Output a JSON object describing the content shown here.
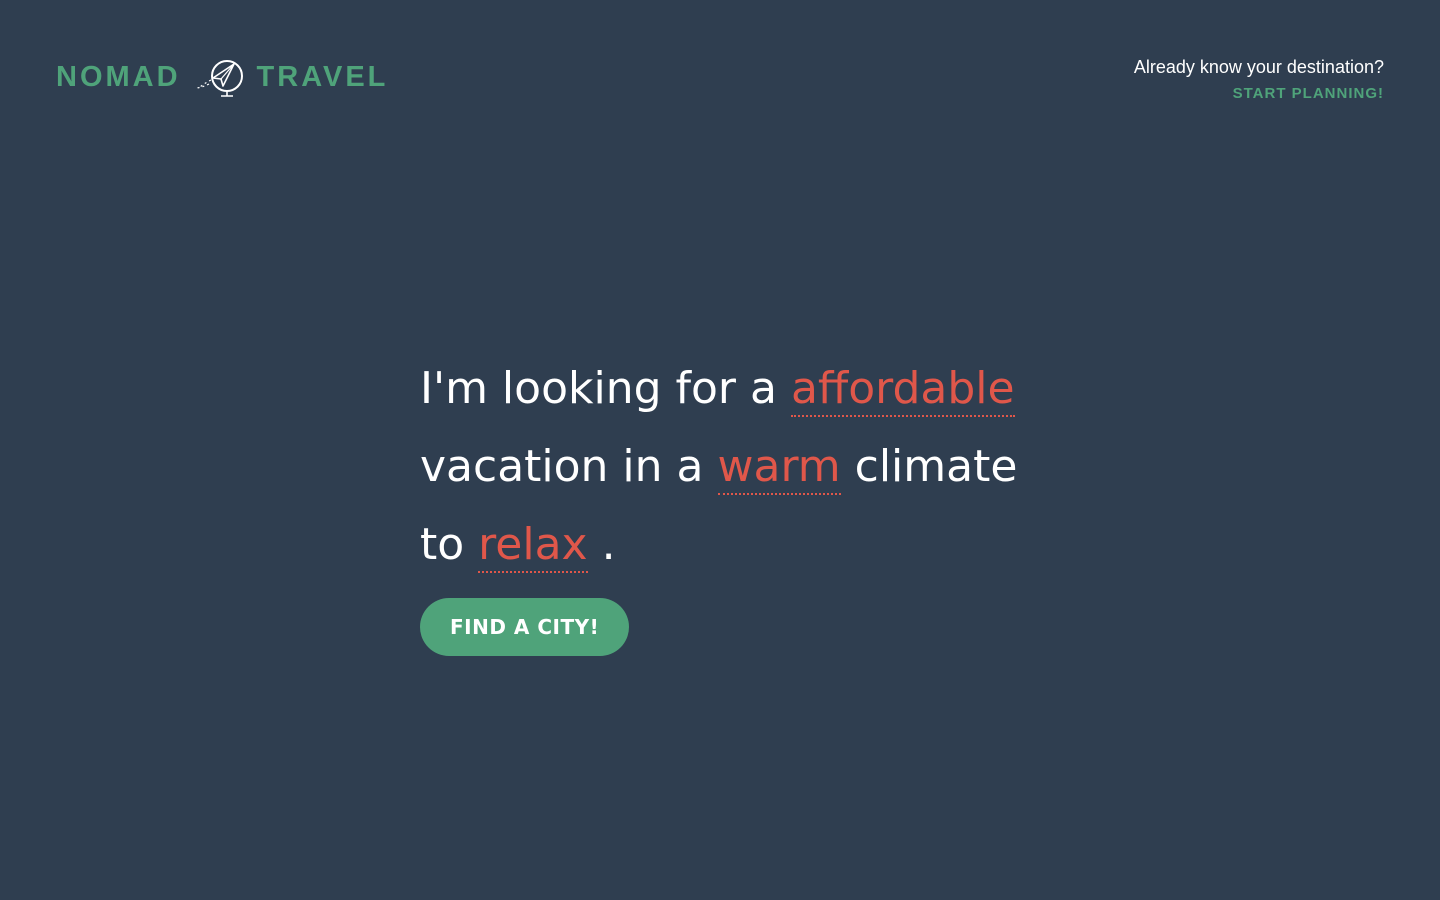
{
  "header": {
    "logo": {
      "left_word": "NOMAD",
      "right_word": "TRAVEL",
      "emblem_icon": "paper-plane-globe-icon"
    },
    "question": "Already know your destination?",
    "start_planning_label": "START PLANNING!"
  },
  "hero": {
    "part1": "I'm looking for a",
    "budget_choice": "affordable",
    "part2": "vacation in a",
    "climate_choice": "warm",
    "part3": "climate",
    "part4": "to",
    "purpose_choice": "relax",
    "end": ".",
    "button_label": "FIND A CITY!"
  },
  "colors": {
    "background": "#2f3e50",
    "brand_green": "#4fa37a",
    "accent_red": "#e0574a",
    "text_white": "#ffffff"
  }
}
